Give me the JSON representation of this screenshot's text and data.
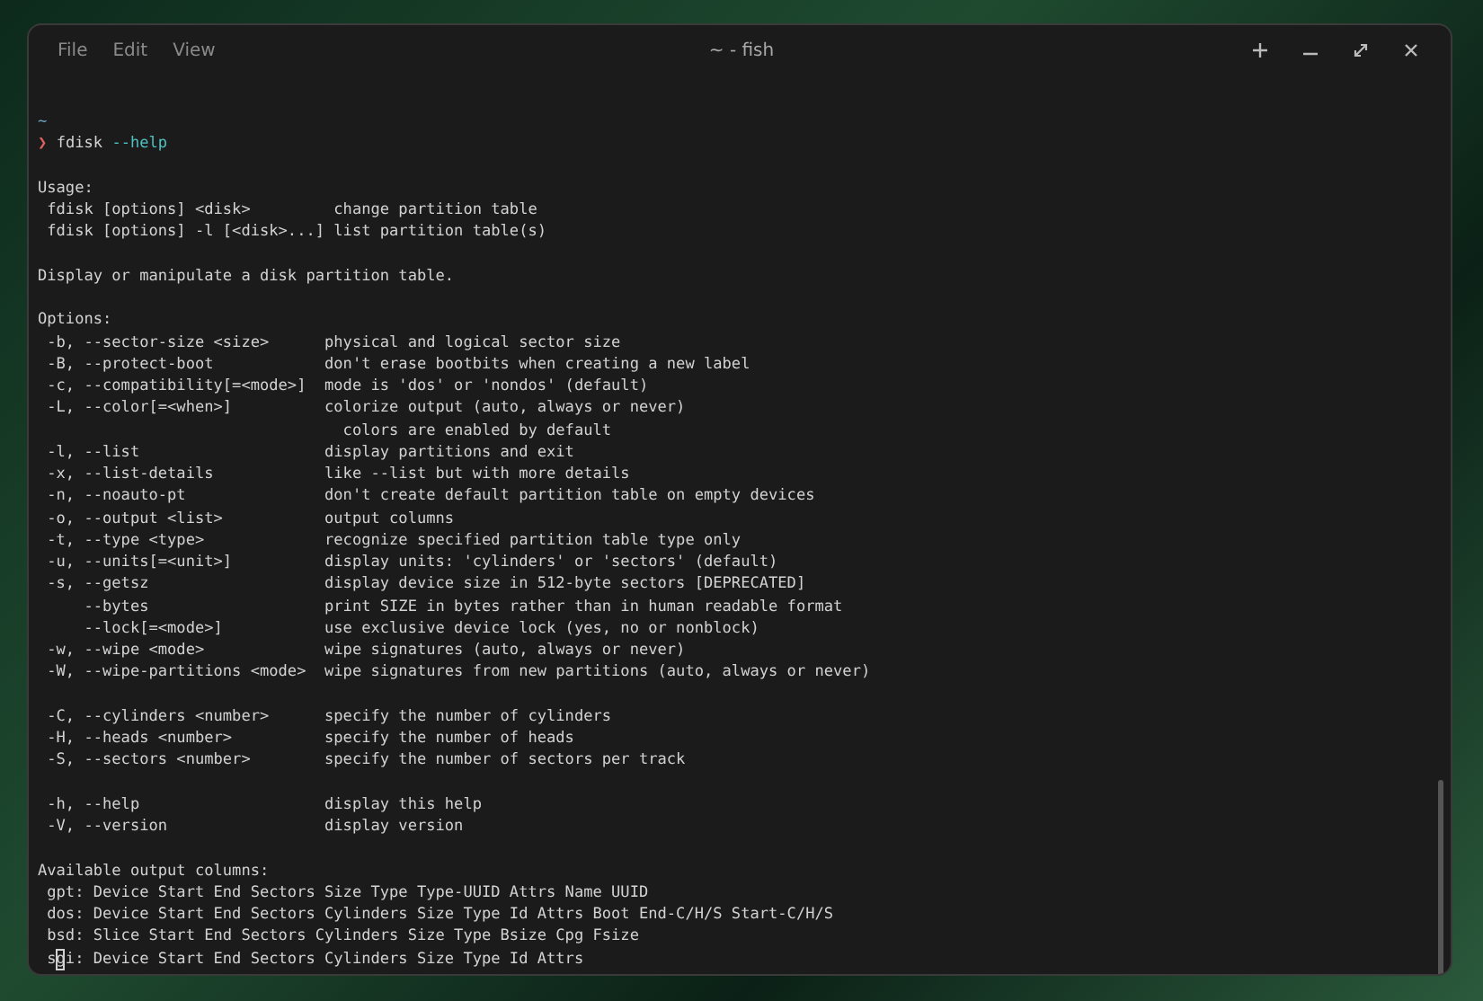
{
  "window": {
    "title": "~ - fish"
  },
  "menu": [
    {
      "label": "File"
    },
    {
      "label": "Edit"
    },
    {
      "label": "View"
    }
  ],
  "window_buttons": [
    {
      "kind": "new-tab"
    },
    {
      "kind": "minimize"
    },
    {
      "kind": "maximize"
    },
    {
      "kind": "close"
    }
  ],
  "terminal": {
    "lines": [
      {
        "kind": "cwd",
        "text": "~"
      },
      {
        "kind": "prompt",
        "symbol": "❯",
        "command": "fdisk",
        "argument": "--help"
      },
      {
        "kind": "blank"
      },
      {
        "kind": "text",
        "text": "Usage:"
      },
      {
        "kind": "text",
        "text": " fdisk [options] <disk>         change partition table"
      },
      {
        "kind": "text",
        "text": " fdisk [options] -l [<disk>...] list partition table(s)"
      },
      {
        "kind": "blank"
      },
      {
        "kind": "text",
        "text": "Display or manipulate a disk partition table."
      },
      {
        "kind": "blank"
      },
      {
        "kind": "text",
        "text": "Options:"
      },
      {
        "kind": "text",
        "text": " -b, --sector-size <size>      physical and logical sector size"
      },
      {
        "kind": "text",
        "text": " -B, --protect-boot            don't erase bootbits when creating a new label"
      },
      {
        "kind": "text",
        "text": " -c, --compatibility[=<mode>]  mode is 'dos' or 'nondos' (default)"
      },
      {
        "kind": "text",
        "text": " -L, --color[=<when>]          colorize output (auto, always or never)"
      },
      {
        "kind": "text",
        "text": "                                 colors are enabled by default"
      },
      {
        "kind": "text",
        "text": " -l, --list                    display partitions and exit"
      },
      {
        "kind": "text",
        "text": " -x, --list-details            like --list but with more details"
      },
      {
        "kind": "text",
        "text": " -n, --noauto-pt               don't create default partition table on empty devices"
      },
      {
        "kind": "text",
        "text": " -o, --output <list>           output columns"
      },
      {
        "kind": "text",
        "text": " -t, --type <type>             recognize specified partition table type only"
      },
      {
        "kind": "text",
        "text": " -u, --units[=<unit>]          display units: 'cylinders' or 'sectors' (default)"
      },
      {
        "kind": "text",
        "text": " -s, --getsz                   display device size in 512-byte sectors [DEPRECATED]"
      },
      {
        "kind": "text",
        "text": "     --bytes                   print SIZE in bytes rather than in human readable format"
      },
      {
        "kind": "text",
        "text": "     --lock[=<mode>]           use exclusive device lock (yes, no or nonblock)"
      },
      {
        "kind": "text",
        "text": " -w, --wipe <mode>             wipe signatures (auto, always or never)"
      },
      {
        "kind": "text",
        "text": " -W, --wipe-partitions <mode>  wipe signatures from new partitions (auto, always or never)"
      },
      {
        "kind": "blank"
      },
      {
        "kind": "text",
        "text": " -C, --cylinders <number>      specify the number of cylinders"
      },
      {
        "kind": "text",
        "text": " -H, --heads <number>          specify the number of heads"
      },
      {
        "kind": "text",
        "text": " -S, --sectors <number>        specify the number of sectors per track"
      },
      {
        "kind": "blank"
      },
      {
        "kind": "text",
        "text": " -h, --help                    display this help"
      },
      {
        "kind": "text",
        "text": " -V, --version                 display version"
      },
      {
        "kind": "blank"
      },
      {
        "kind": "text",
        "text": "Available output columns:"
      },
      {
        "kind": "text",
        "text": " gpt: Device Start End Sectors Size Type Type-UUID Attrs Name UUID"
      },
      {
        "kind": "text",
        "text": " dos: Device Start End Sectors Cylinders Size Type Id Attrs Boot End-C/H/S Start-C/H/S"
      },
      {
        "kind": "text",
        "text": " bsd: Slice Start End Sectors Cylinders Size Type Bsize Cpg Fsize"
      },
      {
        "kind": "text",
        "text": " sgi: Device Start End Sectors Cylinders Size Type Id Attrs",
        "cursor": true
      }
    ]
  }
}
